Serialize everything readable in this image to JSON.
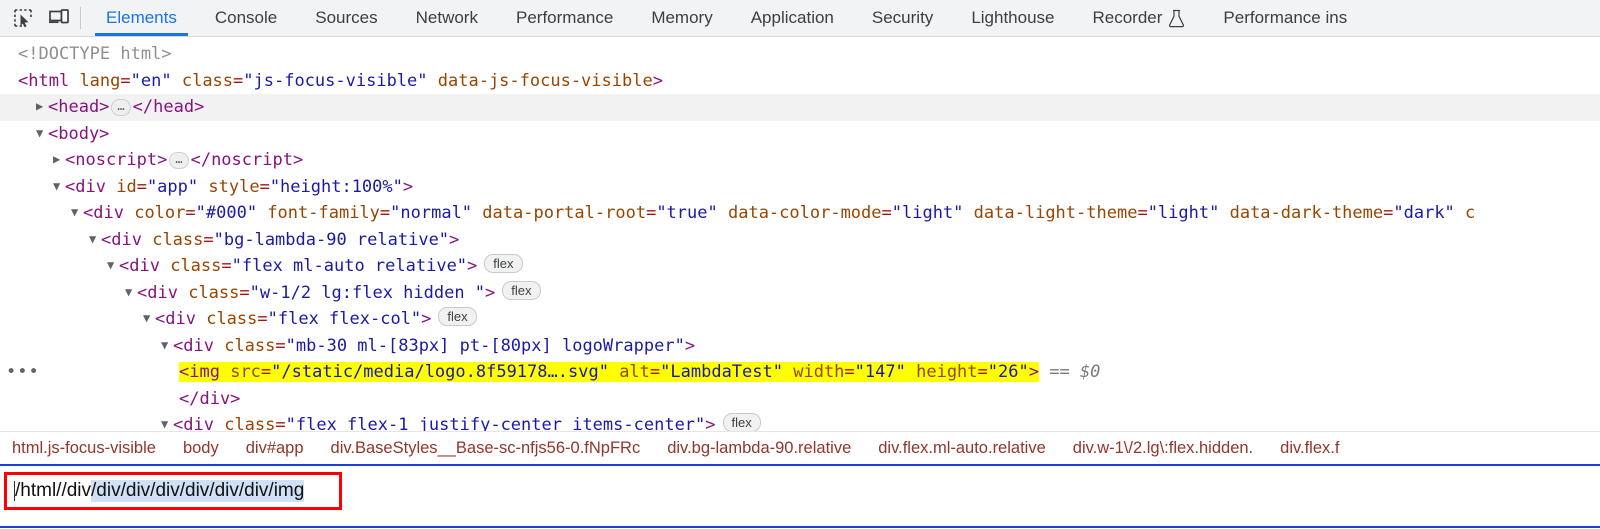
{
  "toolbar": {
    "icons": [
      {
        "name": "inspect-element-icon",
        "title": "Inspect element"
      },
      {
        "name": "device-toolbar-icon",
        "title": "Toggle device toolbar"
      }
    ],
    "tabs": [
      {
        "label": "Elements",
        "active": true
      },
      {
        "label": "Console",
        "active": false
      },
      {
        "label": "Sources",
        "active": false
      },
      {
        "label": "Network",
        "active": false
      },
      {
        "label": "Performance",
        "active": false
      },
      {
        "label": "Memory",
        "active": false
      },
      {
        "label": "Application",
        "active": false
      },
      {
        "label": "Security",
        "active": false
      },
      {
        "label": "Lighthouse",
        "active": false
      },
      {
        "label": "Recorder",
        "active": false,
        "icon": "flask-icon"
      },
      {
        "label": "Performance ins",
        "active": false
      }
    ],
    "active_tab_color": "#1a73e8",
    "background": "#f1f3f4"
  },
  "dom_tree": {
    "lines": [
      {
        "id": "doctype",
        "text": "<!DOCTYPE html>"
      },
      {
        "id": "html",
        "text": "<html lang=\"en\" class=\"js-focus-visible\" data-js-focus-visible>"
      },
      {
        "id": "head",
        "text": "<head> … </head>"
      },
      {
        "id": "body",
        "text": "<body>"
      },
      {
        "id": "noscript",
        "text": "<noscript> … </noscript>"
      },
      {
        "id": "app",
        "text": "<div id=\"app\" style=\"height:100%\">"
      },
      {
        "id": "basestyles",
        "text": "<div color=\"#000\" font-family=\"normal\" data-portal-root=\"true\" data-color-mode=\"light\" data-light-theme=\"light\" data-dark-theme=\"dark\" c"
      },
      {
        "id": "bg-lambda",
        "text": "<div class=\"bg-lambda-90 relative\">"
      },
      {
        "id": "flex-ml-auto",
        "text": "<div class=\"flex  ml-auto relative\">",
        "badge": "flex"
      },
      {
        "id": "w-half",
        "text": "<div class=\"w-1/2 lg:flex hidden \">",
        "badge": "flex"
      },
      {
        "id": "flex-col",
        "text": "<div class=\"flex flex-col\">",
        "badge": "flex"
      },
      {
        "id": "logowrapper",
        "text": "<div class=\"mb-30 ml-[83px] pt-[80px] logoWrapper\">"
      },
      {
        "id": "img",
        "text": "<img src=\"/static/media/logo.8f59178….svg\" alt=\"LambdaTest\" width=\"147\" height=\"26\">",
        "suffix": "== $0",
        "selected": true,
        "gutter": "•••"
      },
      {
        "id": "closediv",
        "text": "</div>"
      },
      {
        "id": "flex-1",
        "text": "<div class=\"flex flex-1 justify-center items-center\">",
        "badge": "flex"
      }
    ],
    "parts": {
      "doctype": "<!DOCTYPE html>",
      "html_tag_open": "<html",
      "html_attr_lang": "lang",
      "html_val_lang": "\"en\"",
      "html_attr_class": "class",
      "html_val_class": "\"js-focus-visible\"",
      "html_attr_dataattr": "data-js-focus-visible",
      "html_close_bracket": ">",
      "head_open": "<head>",
      "head_close": "</head>",
      "body_open": "<body>",
      "noscript_open": "<noscript>",
      "noscript_close": "</noscript>",
      "div_open": "<div",
      "div_close_bracket": ">",
      "img_open": "<img",
      "closing_div": "</div>",
      "attr_id": "id",
      "val_app": "\"app\"",
      "attr_style": "style",
      "val_height": "\"height:100%\"",
      "attr_color": "color",
      "val_000": "\"#000\"",
      "attr_fontfamily": "font-family",
      "val_normal": "\"normal\"",
      "attr_portalroot": "data-portal-root",
      "val_true": "\"true\"",
      "attr_colormode": "data-color-mode",
      "val_light": "\"light\"",
      "attr_lighttheme": "data-light-theme",
      "val_light2": "\"light\"",
      "attr_darktheme": "data-dark-theme",
      "val_dark": "\"dark\"",
      "trailing_c": "c",
      "attr_class": "class",
      "val_bglambda": "\"bg-lambda-90 relative\"",
      "val_flexmlauto": "\"flex  ml-auto relative\"",
      "val_whalf": "\"w-1/2 lg:flex hidden \"",
      "val_flexcol": "\"flex flex-col\"",
      "val_logowrapper": "\"mb-30 ml-[83px] pt-[80px] logoWrapper\"",
      "val_flex1": "\"flex flex-1 justify-center items-center\"",
      "attr_src": "src",
      "val_src": "\"/static/media/logo.8f59178….svg\"",
      "attr_alt": "alt",
      "val_alt": "\"LambdaTest\"",
      "attr_width": "width",
      "val_width": "\"147\"",
      "attr_height": "height",
      "val_height2": "\"26\"",
      "badge_flex": "flex",
      "ellipsis": "…",
      "gutter_dots": "•••",
      "eq_dollar": "== $0"
    }
  },
  "breadcrumb": {
    "items": [
      "html.js-focus-visible",
      "body",
      "div#app",
      "div.BaseStyles__Base-sc-nfjs56-0.fNpFRc",
      "div.bg-lambda-90.relative",
      "div.flex.ml-auto.relative",
      "div.w-1\\/2.lg\\:flex.hidden.",
      "div.flex.f"
    ]
  },
  "search": {
    "value_prefix": "/html//div",
    "value_selected": "/div/div/div/div/div/div/img",
    "full_value": "/html//div/div/div/div/div/div/div/img",
    "highlight_border_color": "#ff0000"
  }
}
